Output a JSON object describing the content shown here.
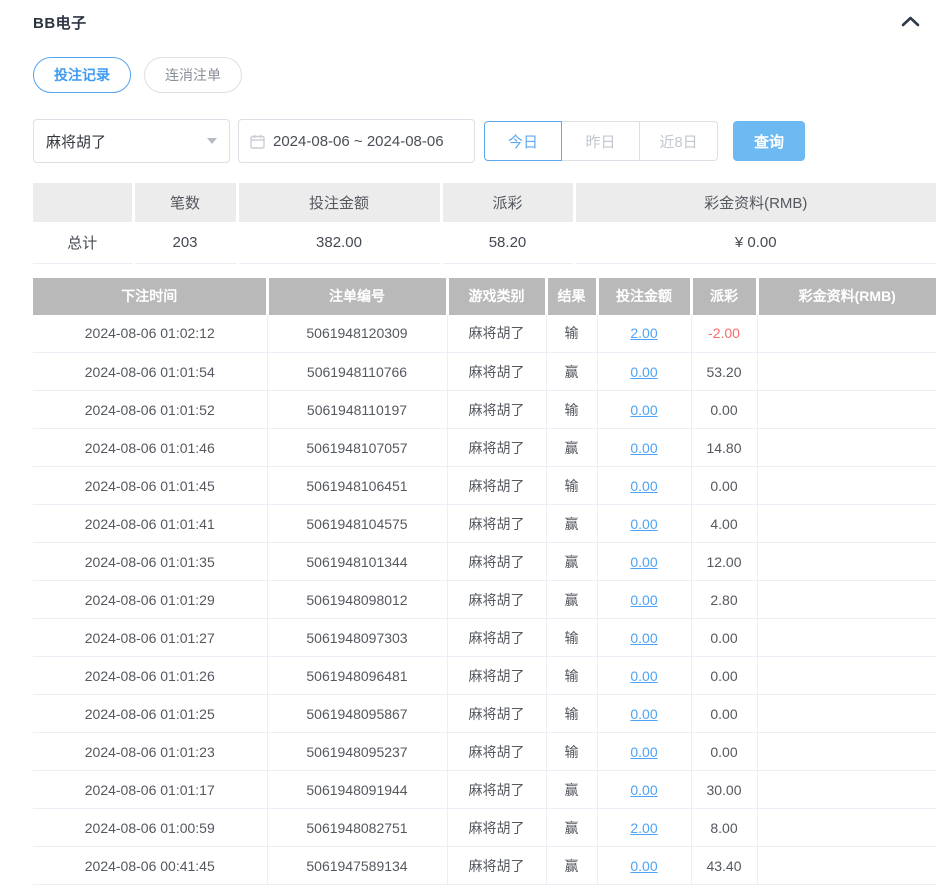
{
  "panel": {
    "title": "BB电子",
    "collapse_icon": "chevron-up-icon"
  },
  "tabs": [
    {
      "label": "投注记录",
      "active": true
    },
    {
      "label": "连消注单",
      "active": false
    }
  ],
  "filters": {
    "game_select": {
      "value": "麻将胡了",
      "icon": "caret-down-icon"
    },
    "date_range": {
      "value": "2024-08-06 ~ 2024-08-06",
      "icon": "calendar-icon"
    },
    "quick_buttons": [
      {
        "label": "今日",
        "active": true
      },
      {
        "label": "昨日",
        "active": false
      },
      {
        "label": "近8日",
        "active": false
      }
    ],
    "search_label": "查询"
  },
  "summary": {
    "headers": [
      "",
      "笔数",
      "投注金额",
      "派彩",
      "彩金资料(RMB)"
    ],
    "total_row": {
      "label": "总计",
      "count": "203",
      "bet_amount": "382.00",
      "payout": "58.20",
      "bonus": "¥ 0.00"
    }
  },
  "records": {
    "headers": [
      "下注时间",
      "注单编号",
      "游戏类别",
      "结果",
      "投注金额",
      "派彩",
      "彩金资料(RMB)"
    ],
    "rows": [
      {
        "time": "2024-08-06 01:02:12",
        "order": "5061948120309",
        "game": "麻将胡了",
        "result": "输",
        "bet": "2.00",
        "payout": "-2.00",
        "bonus": ""
      },
      {
        "time": "2024-08-06 01:01:54",
        "order": "5061948110766",
        "game": "麻将胡了",
        "result": "赢",
        "bet": "0.00",
        "payout": "53.20",
        "bonus": ""
      },
      {
        "time": "2024-08-06 01:01:52",
        "order": "5061948110197",
        "game": "麻将胡了",
        "result": "输",
        "bet": "0.00",
        "payout": "0.00",
        "bonus": ""
      },
      {
        "time": "2024-08-06 01:01:46",
        "order": "5061948107057",
        "game": "麻将胡了",
        "result": "赢",
        "bet": "0.00",
        "payout": "14.80",
        "bonus": ""
      },
      {
        "time": "2024-08-06 01:01:45",
        "order": "5061948106451",
        "game": "麻将胡了",
        "result": "输",
        "bet": "0.00",
        "payout": "0.00",
        "bonus": ""
      },
      {
        "time": "2024-08-06 01:01:41",
        "order": "5061948104575",
        "game": "麻将胡了",
        "result": "赢",
        "bet": "0.00",
        "payout": "4.00",
        "bonus": ""
      },
      {
        "time": "2024-08-06 01:01:35",
        "order": "5061948101344",
        "game": "麻将胡了",
        "result": "赢",
        "bet": "0.00",
        "payout": "12.00",
        "bonus": ""
      },
      {
        "time": "2024-08-06 01:01:29",
        "order": "5061948098012",
        "game": "麻将胡了",
        "result": "赢",
        "bet": "0.00",
        "payout": "2.80",
        "bonus": ""
      },
      {
        "time": "2024-08-06 01:01:27",
        "order": "5061948097303",
        "game": "麻将胡了",
        "result": "输",
        "bet": "0.00",
        "payout": "0.00",
        "bonus": ""
      },
      {
        "time": "2024-08-06 01:01:26",
        "order": "5061948096481",
        "game": "麻将胡了",
        "result": "输",
        "bet": "0.00",
        "payout": "0.00",
        "bonus": ""
      },
      {
        "time": "2024-08-06 01:01:25",
        "order": "5061948095867",
        "game": "麻将胡了",
        "result": "输",
        "bet": "0.00",
        "payout": "0.00",
        "bonus": ""
      },
      {
        "time": "2024-08-06 01:01:23",
        "order": "5061948095237",
        "game": "麻将胡了",
        "result": "输",
        "bet": "0.00",
        "payout": "0.00",
        "bonus": ""
      },
      {
        "time": "2024-08-06 01:01:17",
        "order": "5061948091944",
        "game": "麻将胡了",
        "result": "赢",
        "bet": "0.00",
        "payout": "30.00",
        "bonus": ""
      },
      {
        "time": "2024-08-06 01:00:59",
        "order": "5061948082751",
        "game": "麻将胡了",
        "result": "赢",
        "bet": "2.00",
        "payout": "8.00",
        "bonus": ""
      },
      {
        "time": "2024-08-06 00:41:45",
        "order": "5061947589134",
        "game": "麻将胡了",
        "result": "赢",
        "bet": "0.00",
        "payout": "43.40",
        "bonus": ""
      }
    ]
  },
  "colors": {
    "accent_blue": "#4da3f5",
    "search_button_bg": "#6db9f2",
    "negative_red": "#f56c6c",
    "table_header_bg": "#b9b9b9",
    "summary_header_bg": "#ececec",
    "input_border": "#dcdfe6",
    "row_border": "#ebeef5",
    "title_text": "#2c3440"
  }
}
